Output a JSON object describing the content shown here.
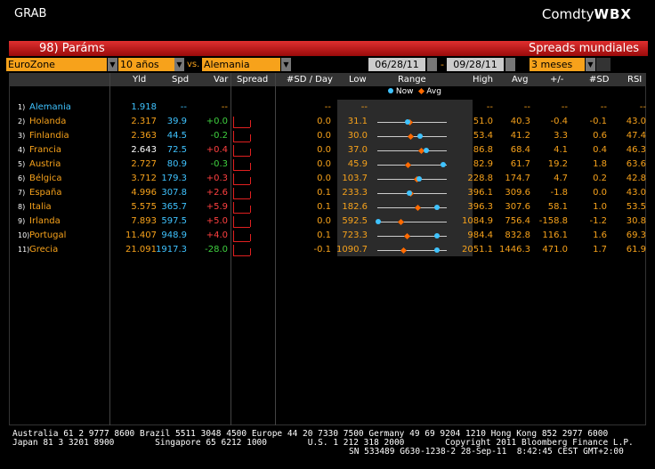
{
  "app": {
    "left_label": "GRAB",
    "right_label_prefix": "Comdty",
    "right_label_brand": "WBX"
  },
  "titlebar": {
    "params": "98) Paráms",
    "title": "Spreads mundiales"
  },
  "controls": {
    "region": "EuroZone",
    "tenor": "10 años",
    "vs": "vs.",
    "benchmark": "Alemania",
    "start_date": "06/28/11",
    "end_date": "09/28/11",
    "date_sep": "-",
    "period": "3 meses"
  },
  "columns": {
    "yld": "Yld",
    "spd": "Spd",
    "var": "Var",
    "spread": "Spread",
    "sd_day": "#SD / Day",
    "low": "Low",
    "range": "Range",
    "high": "High",
    "avg": "Avg",
    "pm": "+/-",
    "sd": "#SD",
    "rsi": "RSI"
  },
  "legend": {
    "now": "Now",
    "avg": "Avg"
  },
  "rows": [
    {
      "num": "1)",
      "name": "Alemania",
      "yld": "1.918",
      "spd": "--",
      "var": "--",
      "sd_day": "--",
      "low": "--",
      "high": "--",
      "avg": "--",
      "pm": "--",
      "sd": "--",
      "rsi": "--",
      "benchmark": true
    },
    {
      "num": "2)",
      "name": "Holanda",
      "yld": "2.317",
      "spd": "39.9",
      "var": "+0.0",
      "sd_day": "0.0",
      "low": "31.1",
      "high": "51.0",
      "avg": "40.3",
      "pm": "-0.4",
      "sd": "-0.1",
      "rsi": "43.0",
      "now_frac": 0.44,
      "avg_frac": 0.46
    },
    {
      "num": "3)",
      "name": "Finlandia",
      "yld": "2.363",
      "spd": "44.5",
      "var": "-0.2",
      "sd_day": "0.0",
      "low": "30.0",
      "high": "53.4",
      "avg": "41.2",
      "pm": "3.3",
      "sd": "0.6",
      "rsi": "47.4",
      "now_frac": 0.62,
      "avg_frac": 0.48
    },
    {
      "num": "4)",
      "name": "Francia",
      "yld": "2.643",
      "spd": "72.5",
      "var": "+0.4",
      "sd_day": "0.0",
      "low": "37.0",
      "high": "86.8",
      "avg": "68.4",
      "pm": "4.1",
      "sd": "0.4",
      "rsi": "46.3",
      "now_frac": 0.71,
      "avg_frac": 0.63
    },
    {
      "num": "5)",
      "name": "Austria",
      "yld": "2.727",
      "spd": "80.9",
      "var": "-0.3",
      "sd_day": "0.0",
      "low": "45.9",
      "high": "82.9",
      "avg": "61.7",
      "pm": "19.2",
      "sd": "1.8",
      "rsi": "63.6",
      "now_frac": 0.95,
      "avg_frac": 0.43
    },
    {
      "num": "6)",
      "name": "Bélgica",
      "yld": "3.712",
      "spd": "179.3",
      "var": "+0.3",
      "sd_day": "0.0",
      "low": "103.7",
      "high": "228.8",
      "avg": "174.7",
      "pm": "4.7",
      "sd": "0.2",
      "rsi": "42.8",
      "now_frac": 0.6,
      "avg_frac": 0.57
    },
    {
      "num": "7)",
      "name": "España",
      "yld": "4.996",
      "spd": "307.8",
      "var": "+2.6",
      "sd_day": "0.1",
      "low": "233.3",
      "high": "396.1",
      "avg": "309.6",
      "pm": "-1.8",
      "sd": "0.0",
      "rsi": "43.0",
      "now_frac": 0.46,
      "avg_frac": 0.47
    },
    {
      "num": "8)",
      "name": "Italia",
      "yld": "5.575",
      "spd": "365.7",
      "var": "+5.9",
      "sd_day": "0.1",
      "low": "182.6",
      "high": "396.3",
      "avg": "307.6",
      "pm": "58.1",
      "sd": "1.0",
      "rsi": "53.5",
      "now_frac": 0.86,
      "avg_frac": 0.58
    },
    {
      "num": "9)",
      "name": "Irlanda",
      "yld": "7.893",
      "spd": "597.5",
      "var": "+5.0",
      "sd_day": "0.0",
      "low": "592.5",
      "high": "1084.9",
      "avg": "756.4",
      "pm": "-158.8",
      "sd": "-1.2",
      "rsi": "30.8",
      "now_frac": 0.01,
      "avg_frac": 0.33
    },
    {
      "num": "10)",
      "name": "Portugal",
      "yld": "11.407",
      "spd": "948.9",
      "var": "+4.0",
      "sd_day": "0.1",
      "low": "723.3",
      "high": "984.4",
      "avg": "832.8",
      "pm": "116.1",
      "sd": "1.6",
      "rsi": "69.3",
      "now_frac": 0.86,
      "avg_frac": 0.42
    },
    {
      "num": "11)",
      "name": "Grecia",
      "yld": "21.091",
      "spd": "1917.3",
      "var": "-28.0",
      "sd_day": "-0.1",
      "low": "1090.7",
      "high": "2051.1",
      "avg": "1446.3",
      "pm": "471.0",
      "sd": "1.7",
      "rsi": "61.9",
      "now_frac": 0.86,
      "avg_frac": 0.37
    }
  ],
  "footer": {
    "line1": "Australia 61 2 9777 8600 Brazil 5511 3048 4500 Europe 44 20 7330 7500 Germany 49 69 9204 1210 Hong Kong 852 2977 6000",
    "line2": "Japan 81 3 3201 8900        Singapore 65 6212 1000        U.S. 1 212 318 2000        Copyright 2011 Bloomberg Finance L.P.",
    "line3": "SN 533489 G630-1238-2 28-Sep-11  8:42:45 CEST GMT+2:00"
  },
  "colors": {
    "orange": "#f7a21b",
    "blue": "#3fc3ff",
    "red": "#e02020",
    "green": "#3fd03f",
    "now_dot": "#3fc3ff",
    "avg_dot": "#ff6a00"
  }
}
